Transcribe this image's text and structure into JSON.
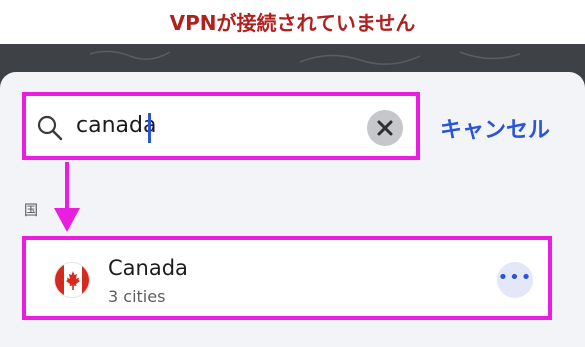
{
  "status": {
    "text": "VPNが接続されていません",
    "color": "#b0201e"
  },
  "search": {
    "value": "canada",
    "cancel_label": "キャンセル"
  },
  "section": {
    "label": "国"
  },
  "results": [
    {
      "name": "Canada",
      "subtitle": "3 cities",
      "flag_icon": "canada-flag-icon"
    }
  ],
  "colors": {
    "accent": "#2b55d6",
    "highlight": "#e91ee0"
  }
}
